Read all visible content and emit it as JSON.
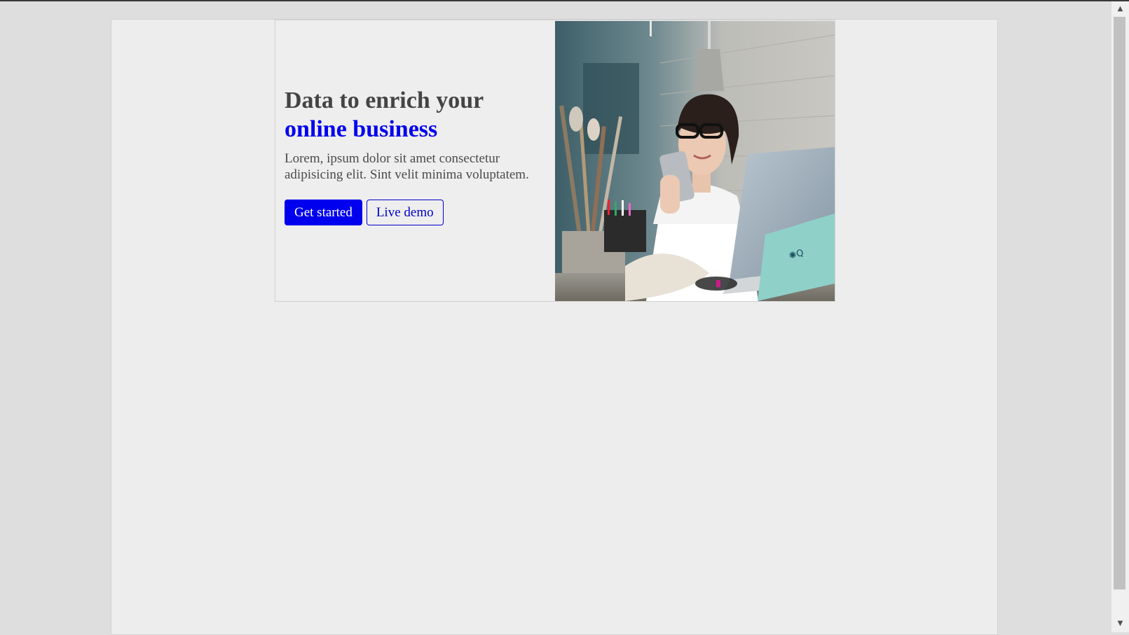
{
  "hero": {
    "headline_line1": "Data to enrich your",
    "headline_line2": "online business",
    "lead": "Lorem, ipsum dolor sit amet consectetur adipisicing elit. Sint velit minima voluptatem.",
    "primary_button": "Get started",
    "secondary_button": "Live demo",
    "image_alt_icon": "person-with-phone-photo"
  },
  "scrollbar": {
    "up_arrow": "▲",
    "down_arrow": "▼"
  },
  "colors": {
    "accent": "#0000ee",
    "text": "#444444",
    "background": "#eeeeee"
  }
}
